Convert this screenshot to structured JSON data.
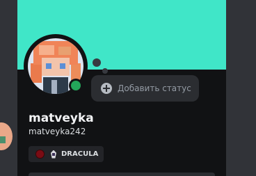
{
  "profile": {
    "display_name": "matveyka",
    "username": "matveyka242",
    "status_button_label": "Добавить статус",
    "online_status": "online",
    "banner_color": "#40e6c8",
    "status_color": "#23a55a"
  },
  "tag": {
    "text": "DRACULA",
    "icon": "dracula-guild-icon",
    "color": "#7a0c14"
  }
}
